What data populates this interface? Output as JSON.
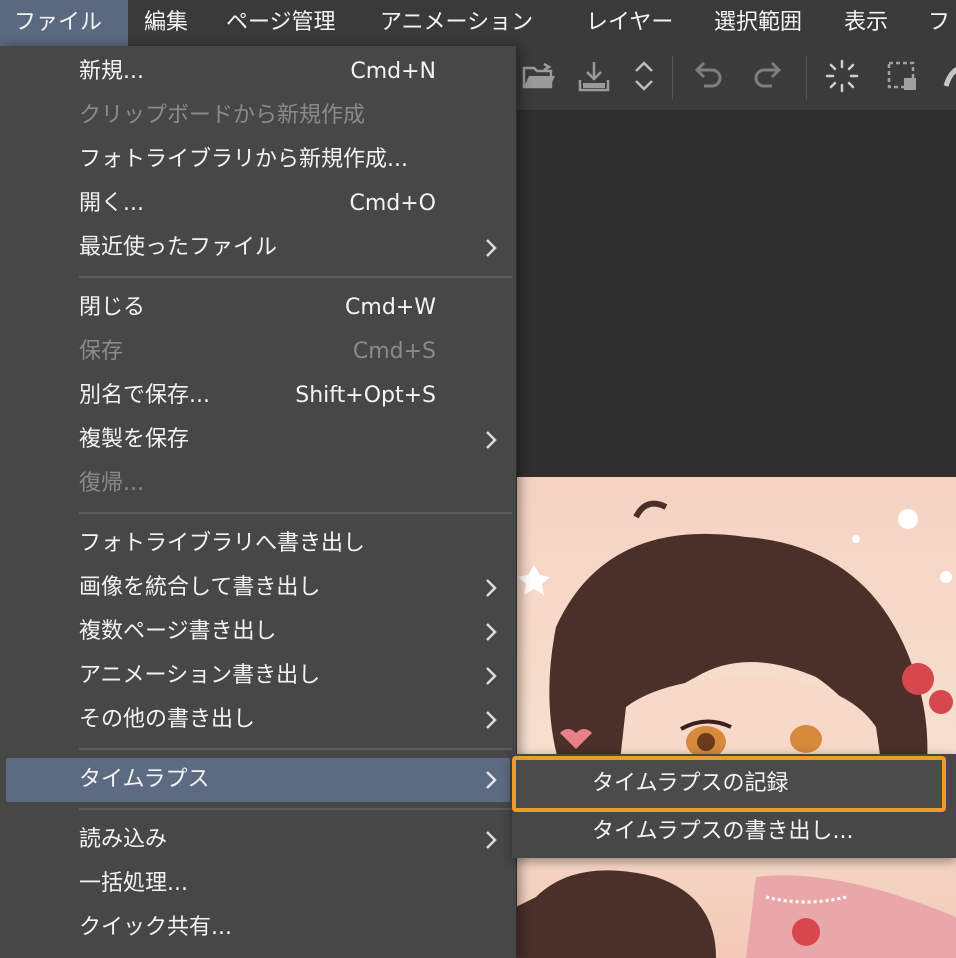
{
  "menubar": {
    "items": [
      "ファイル",
      "編集",
      "ページ管理",
      "アニメーション",
      "レイヤー",
      "選択範囲",
      "表示",
      "フ"
    ]
  },
  "file_menu": {
    "new": {
      "label": "新規...",
      "shortcut": "Cmd+N"
    },
    "new_from_clipboard": {
      "label": "クリップボードから新規作成"
    },
    "new_from_photo_library": {
      "label": "フォトライブラリから新規作成..."
    },
    "open": {
      "label": "開く...",
      "shortcut": "Cmd+O"
    },
    "recent": {
      "label": "最近使ったファイル"
    },
    "close": {
      "label": "閉じる",
      "shortcut": "Cmd+W"
    },
    "save": {
      "label": "保存",
      "shortcut": "Cmd+S"
    },
    "save_as": {
      "label": "別名で保存...",
      "shortcut": "Shift+Opt+S"
    },
    "save_duplicate": {
      "label": "複製を保存"
    },
    "revert": {
      "label": "復帰..."
    },
    "export_photo_library": {
      "label": "フォトライブラリへ書き出し"
    },
    "export_flattened": {
      "label": "画像を統合して書き出し"
    },
    "export_multiple_pages": {
      "label": "複数ページ書き出し"
    },
    "export_animation": {
      "label": "アニメーション書き出し"
    },
    "export_other": {
      "label": "その他の書き出し"
    },
    "timelapse": {
      "label": "タイムラプス"
    },
    "import": {
      "label": "読み込み"
    },
    "batch": {
      "label": "一括処理..."
    },
    "quick_share": {
      "label": "クイック共有..."
    }
  },
  "timelapse_submenu": {
    "record": "タイムラプスの記録",
    "export": "タイムラプスの書き出し..."
  },
  "colors": {
    "menubar_active": "#5a6880",
    "highlight": "#5d6b82",
    "focus_ring": "#f09a2a"
  }
}
